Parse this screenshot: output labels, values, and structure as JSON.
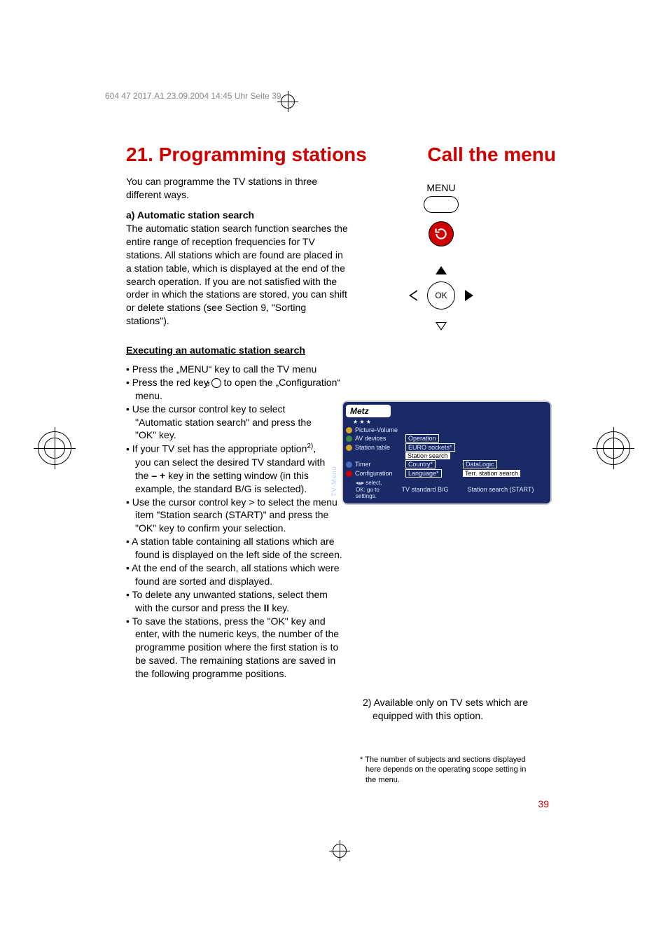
{
  "meta_header": "604 47 2017.A1  23.09.2004  14:45 Uhr  Seite 39",
  "title_left": "21. Programming stations",
  "title_right": "Call the menu",
  "intro": "You can programme the TV stations in three different ways.",
  "heading_a": "a) Automatic station search",
  "para_a": "The automatic station search function searches the entire range of reception frequencies for TV stations. All stations which are found are placed in a station table, which is displayed at the end of the search operation. If you are not satisfied with the order in which the stations are stored, you can shift or delete stations (see Section 9, \"Sorting stations\").",
  "heading_exec": "Executing an automatic station search",
  "bullets": {
    "b1": "Press the „MENU“ key to call the TV menu",
    "b2a": "Press the red key ",
    "b2b": " to open the „Configuration“ menu.",
    "b3": "Use the cursor control key to select \"Automatic station search\" and press the \"OK\" key.",
    "b4a": "If your TV set has the appropriate option",
    "b4b": "2)",
    "b4c": ", you can select the desired TV standard with the ",
    "b4d": "– +",
    "b4e": " key in the setting window (in this example, the standard B/G is selected).",
    "b5": "Use the cursor control key > to select the menu item \"Station search (START)\" and press the \"OK\" key to confirm your selection.",
    "b6": "A station table containing all stations which are found is displayed on the left side of the screen.",
    "b7": "At the end of the search, all stations which were found are sorted and displayed.",
    "b8a": "To delete any unwanted stations, select them with the cursor and press the ",
    "b8b": "II",
    "b8c": " key.",
    "b9": "To save the stations, press the \"OK\" key and enter, with the numeric keys, the number of the programme position where the first station is to be saved. The remaining stations are saved in the following programme positions."
  },
  "menu": {
    "label": "MENU",
    "ok": "OK"
  },
  "osd": {
    "logo": "Metz",
    "stars": "★  ★  ★",
    "side": "TV-Menü",
    "rows": {
      "picture": "Picture-Volume",
      "av": "AV devices",
      "station": "Station table",
      "timer": "Timer",
      "config": "Configuration"
    },
    "col2": {
      "operation": "Operation",
      "euro": "EURO sockets*",
      "search": "Station search",
      "country": "Country*",
      "language": "Language*"
    },
    "col3": {
      "datalogic": "DataLogic",
      "terr": "Terr. station search"
    },
    "hint": "◂▴▸ select,\nOK: go to settings.",
    "status_left": "TV standard   B/G",
    "status_right": "Station search  (START)"
  },
  "note2": "2) Available only on TV sets which are equipped with this option.",
  "footnote": "* The number of subjects and sections displayed here depends on the operating scope setting in the menu.",
  "pagenum": "39"
}
